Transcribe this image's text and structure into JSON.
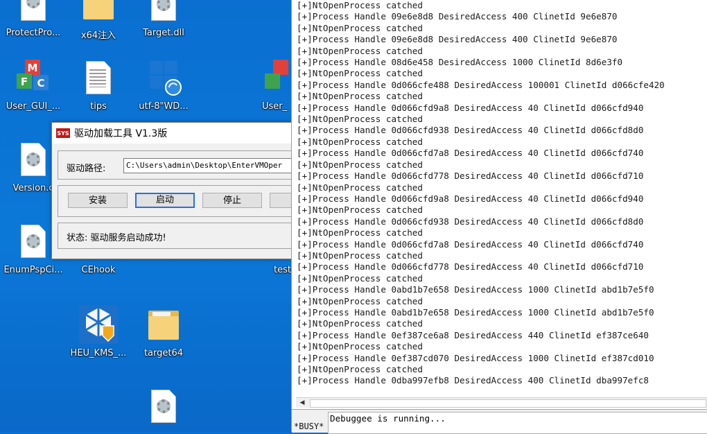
{
  "desktop": {
    "icons": [
      {
        "label": "ProtectPro...",
        "icon": "document-icon"
      },
      {
        "label": "x64注入",
        "icon": "folder-icon"
      },
      {
        "label": "Target.dll",
        "icon": "settings-file-icon"
      },
      {
        "label": "User_GUI_...",
        "icon": "mfc-app-icon"
      },
      {
        "label": "tips",
        "icon": "text-document-icon"
      },
      {
        "label": "utf-8\"WD...",
        "icon": "windows-shield-icon"
      },
      {
        "label": "User_",
        "icon": "mfc-app-icon"
      },
      {
        "label": "Version.c",
        "icon": "settings-file-icon"
      },
      {
        "label": "EnumPspCi...",
        "icon": "settings-file-icon"
      },
      {
        "label": "CEhook",
        "icon": "document-icon"
      },
      {
        "label": "test",
        "icon": "document-icon"
      },
      {
        "label": "HEU_KMS_...",
        "icon": "heu-kms-icon"
      },
      {
        "label": "target64",
        "icon": "folder-icon"
      },
      {
        "label": "",
        "icon": "settings-file-icon"
      }
    ]
  },
  "dialog": {
    "title": "驱动加载工具 V1.3版",
    "title_icon_text": "SYS",
    "path_label": "驱动路径:",
    "path_value": "C:\\Users\\admin\\Desktop\\EnterVMOper",
    "buttons": {
      "install": "安装",
      "start": "启动",
      "stop": "停止"
    },
    "status": "状态: 驱动服务启动成功!"
  },
  "debugger": {
    "log_lines": [
      "[+]NtOpenProcess catched",
      "[+]Process Handle 09e6e8d8 DesiredAccess 400 ClinetId 9e6e870",
      "[+]NtOpenProcess catched",
      "[+]Process Handle 09e6e8d8 DesiredAccess 400 ClinetId 9e6e870",
      "[+]NtOpenProcess catched",
      "[+]Process Handle 08d6e458 DesiredAccess 1000 ClinetId 8d6e3f0",
      "[+]NtOpenProcess catched",
      "[+]Process Handle 0d066cfe488 DesiredAccess 100001 ClinetId d066cfe420",
      "[+]NtOpenProcess catched",
      "[+]Process Handle 0d066cfd9a8 DesiredAccess 40 ClinetId d066cfd940",
      "[+]NtOpenProcess catched",
      "[+]Process Handle 0d066cfd938 DesiredAccess 40 ClinetId d066cfd8d0",
      "[+]NtOpenProcess catched",
      "[+]Process Handle 0d066cfd7a8 DesiredAccess 40 ClinetId d066cfd740",
      "[+]NtOpenProcess catched",
      "[+]Process Handle 0d066cfd778 DesiredAccess 40 ClinetId d066cfd710",
      "[+]NtOpenProcess catched",
      "[+]Process Handle 0d066cfd9a8 DesiredAccess 40 ClinetId d066cfd940",
      "[+]NtOpenProcess catched",
      "[+]Process Handle 0d066cfd938 DesiredAccess 40 ClinetId d066cfd8d0",
      "[+]NtOpenProcess catched",
      "[+]Process Handle 0d066cfd7a8 DesiredAccess 40 ClinetId d066cfd740",
      "[+]NtOpenProcess catched",
      "[+]Process Handle 0d066cfd778 DesiredAccess 40 ClinetId d066cfd710",
      "[+]NtOpenProcess catched",
      "[+]Process Handle 0abd1b7e658 DesiredAccess 1000 ClinetId abd1b7e5f0",
      "[+]NtOpenProcess catched",
      "[+]Process Handle 0abd1b7e658 DesiredAccess 1000 ClinetId abd1b7e5f0",
      "[+]NtOpenProcess catched",
      "[+]Process Handle 0ef387ce6a8 DesiredAccess 440 ClinetId ef387ce640",
      "[+]NtOpenProcess catched",
      "[+]Process Handle 0ef387cd070 DesiredAccess 1000 ClinetId ef387cd010",
      "[+]NtOpenProcess catched",
      "[+]Process Handle 0dba997efb8 DesiredAccess 400 ClinetId dba997efc8"
    ],
    "busy_label": "*BUSY*",
    "command_output": "Debuggee is running...",
    "scroll_left_glyph": "◀"
  }
}
